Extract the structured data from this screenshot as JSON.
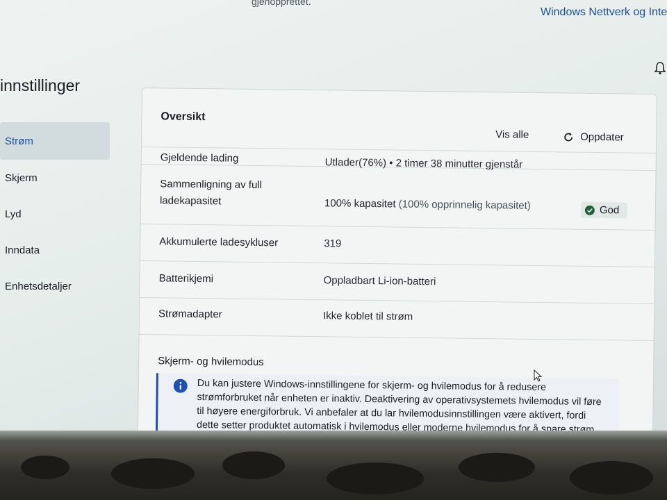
{
  "top_bar": {
    "partial_text": "gjenopprettet.",
    "network_link": "Windows Nettverk og Inter"
  },
  "app": {
    "title": "innstillinger"
  },
  "sidebar": {
    "items": [
      {
        "label": "Strøm",
        "active": true
      },
      {
        "label": "Skjerm",
        "active": false
      },
      {
        "label": "Lyd",
        "active": false
      },
      {
        "label": "Inndata",
        "active": false
      },
      {
        "label": "Enhetsdetaljer",
        "active": false
      }
    ]
  },
  "overview": {
    "title": "Oversikt",
    "show_all": "Vis alle",
    "refresh": "Oppdater",
    "rows": {
      "current_charge": {
        "label": "Gjeldende lading",
        "value": "Utlader(76%)  •  2 timer 38 minutter gjenstår"
      },
      "capacity": {
        "label": "Sammenligning av full ladekapasitet",
        "value_main": "100% kapasitet ",
        "value_note": "(100% opprinnelig kapasitet)",
        "status": "God"
      },
      "cycles": {
        "label": "Akkumulerte ladesykluser",
        "value": "319"
      },
      "chemistry": {
        "label": "Batterikjemi",
        "value": "Oppladbart Li-ion-batteri"
      },
      "adapter": {
        "label": "Strømadapter",
        "value": "Ikke koblet til strøm"
      }
    },
    "sleep_section": {
      "title": "Skjerm- og hvilemodus",
      "info": "Du kan justere Windows-innstillingene for skjerm- og hvilemodus for å redusere strømforbruket når enheten er inaktiv. Deaktivering av operativsystemets hvilemodus vil føre til høyere energiforbruk. Vi anbefaler at du lar hvilemodusinnstillingen være aktivert, fordi dette setter produktet automatisk i hvilemodus eller moderne hvilemodus for å spare strøm."
    }
  },
  "colors": {
    "accent": "#1d4e9e",
    "status_good": "#1f5f3a",
    "info_bar": "#1f4fb5"
  }
}
